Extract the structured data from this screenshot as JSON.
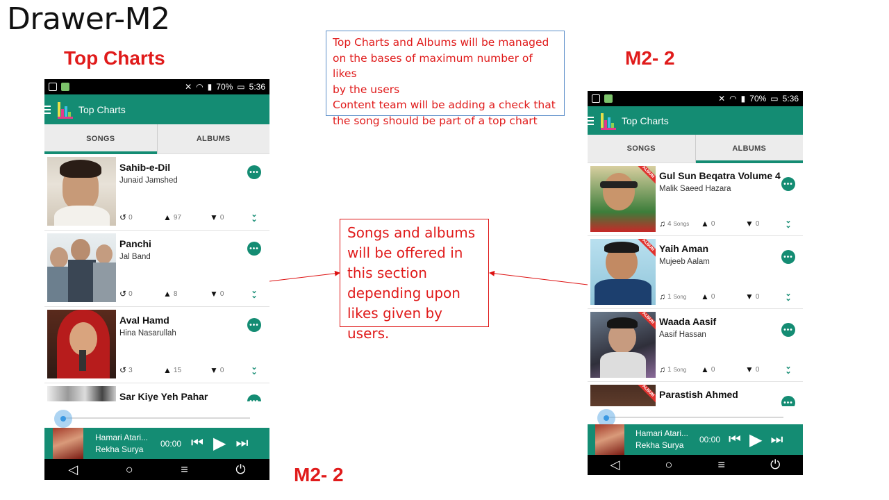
{
  "slide": {
    "title": "Drawer-M2",
    "heading_left": "Top Charts",
    "heading_right": "M2- 2",
    "heading_bottom": "M2- 2",
    "note_top_lines": [
      "Top Charts and Albums will be managed",
      "on the bases of maximum number of likes",
      "by the users",
      "Content team will be adding a check that",
      "the song should be part of a top chart"
    ],
    "note_mid_lines": [
      "Songs and albums",
      "will be offered in",
      "this section",
      "depending upon",
      "likes given by users."
    ]
  },
  "status_bar": {
    "battery": "70%",
    "time": "5:36"
  },
  "app_bar": {
    "title": "Top Charts"
  },
  "tabs": {
    "songs": "SONGS",
    "albums": "ALBUMS"
  },
  "songs_screen": {
    "items": [
      {
        "title": "Sahib-e-Dil",
        "artist": "Junaid Jamshed",
        "plays": "0",
        "likes": "97",
        "dislikes": "0"
      },
      {
        "title": "Panchi",
        "artist": "Jal Band",
        "plays": "0",
        "likes": "8",
        "dislikes": "0"
      },
      {
        "title": "Aval Hamd",
        "artist": "Hina Nasarullah",
        "plays": "3",
        "likes": "15",
        "dislikes": "0"
      },
      {
        "title": "Sar Kiye Yeh Pahar"
      }
    ]
  },
  "albums_screen": {
    "ribbon": "ALBUM",
    "items": [
      {
        "title": "Gul Sun Beqatra Volume 4",
        "artist": "Malik Saeed Hazara",
        "count": "4",
        "count_label": "Songs",
        "likes": "0",
        "dislikes": "0"
      },
      {
        "title": "Yaih Aman",
        "artist": "Mujeeb Aalam",
        "count": "1",
        "count_label": "Song",
        "likes": "0",
        "dislikes": "0"
      },
      {
        "title": "Waada Aasif",
        "artist": "Aasif Hassan",
        "count": "1",
        "count_label": "Song",
        "likes": "0",
        "dislikes": "0"
      },
      {
        "title": "Parastish Ahmed"
      }
    ]
  },
  "player": {
    "track": "Hamari Atari...",
    "artist": "Rekha Surya",
    "time": "00:00"
  },
  "icons": {
    "more": "more-horizontal-icon",
    "expand": "chevron-double-down-icon",
    "plays": "history-icon",
    "likes": "thumbs-up-icon",
    "dislikes": "thumbs-down-icon",
    "songs": "music-note-icon"
  },
  "colors": {
    "accent": "#148c73",
    "annotation_red": "#e01b1b",
    "ribbon": "#e0332f"
  }
}
